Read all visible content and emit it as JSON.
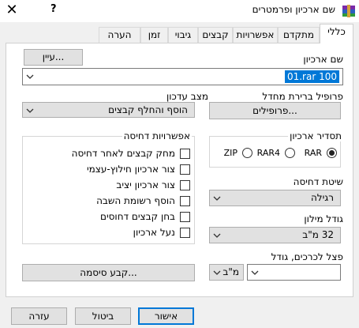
{
  "window": {
    "title": "שם ארכיון ופרמטרים",
    "close_glyph": "✕",
    "help_glyph": "?",
    "app_icon": "winrar-icon"
  },
  "tabs": [
    {
      "label": "כללי",
      "active": true
    },
    {
      "label": "מתקדם",
      "active": false
    },
    {
      "label": "אפשרויות",
      "active": false
    },
    {
      "label": "קבצים",
      "active": false
    },
    {
      "label": "גיבוי",
      "active": false
    },
    {
      "label": "זמן",
      "active": false
    },
    {
      "label": "הערה",
      "active": false
    }
  ],
  "archive_name": {
    "label": "שם ארכיון",
    "browse_label": "עיין...",
    "value": "01.rar      100"
  },
  "profile": {
    "label": "פרופיל ברירת מחדל",
    "button_label": "פרופילים..."
  },
  "update_mode": {
    "label": "מצב עדכון",
    "value": "הוסף והחלף קבצים"
  },
  "archive_format": {
    "label": "תסדיר ארכיון",
    "options": [
      {
        "label": "RAR",
        "selected": true
      },
      {
        "label": "RAR4",
        "selected": false
      },
      {
        "label": "ZIP",
        "selected": false
      }
    ]
  },
  "compression_method": {
    "label": "שיטת דחיסה",
    "value": "רגילה"
  },
  "dictionary_size": {
    "label": "גודל מילון",
    "value": "32 מ\"ב"
  },
  "split_volumes": {
    "label": "פצל לכרכים, גודל",
    "value": "",
    "unit": "מ\"ב"
  },
  "compression_options": {
    "label": "אפשרויות דחיסה",
    "items": [
      {
        "label": "מחק קבצים לאחר דחיסה",
        "checked": false
      },
      {
        "label": "צור ארכיון חילוץ-עצמי",
        "checked": false
      },
      {
        "label": "צור ארכיון יציב",
        "checked": false
      },
      {
        "label": "הוסף רשומת השבה",
        "checked": false
      },
      {
        "label": "בחן קבצים דחוסים",
        "checked": false
      },
      {
        "label": "נעל ארכיון",
        "checked": false
      }
    ]
  },
  "password_button": "קבע סיסמה...",
  "buttons": {
    "ok": "אישור",
    "cancel": "ביטול",
    "help": "עזרה"
  }
}
